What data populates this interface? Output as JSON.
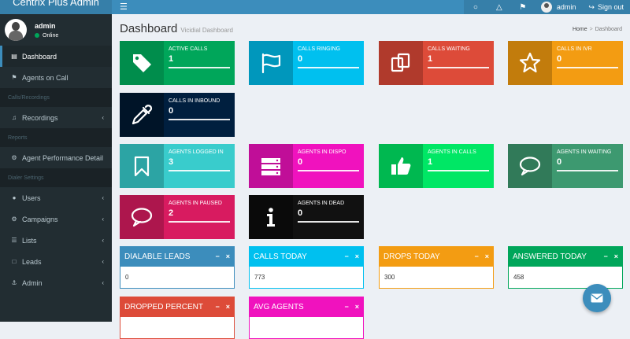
{
  "app": {
    "brand": "Centrix Plus Admin"
  },
  "topbar": {
    "user": "admin",
    "signout": "Sign out"
  },
  "sidebar": {
    "user": {
      "name": "admin",
      "status": "Online"
    },
    "items": [
      {
        "label": "Dashboard",
        "icon": "dashboard-icon"
      },
      {
        "label": "Agents on Call",
        "icon": "flag-icon"
      }
    ],
    "headers": [
      "Calls/Recordings",
      "Reports",
      "Dialer Settings"
    ],
    "recordings": {
      "label": "Recordings",
      "icon": "music-icon"
    },
    "reports": {
      "label": "Agent Performance Detail",
      "icon": "gear-icon"
    },
    "settings": [
      {
        "label": "Users",
        "icon": "users-icon"
      },
      {
        "label": "Campaigns",
        "icon": "gear-icon"
      },
      {
        "label": "Lists",
        "icon": "list-icon"
      },
      {
        "label": "Leads",
        "icon": "file-icon"
      },
      {
        "label": "Admin",
        "icon": "anchor-icon"
      }
    ]
  },
  "page": {
    "title": "Dashboard",
    "subtitle": "Vicidial Dashboard",
    "crumb_home": "Home",
    "crumb_current": "Dashboard"
  },
  "boxes": [
    {
      "label": "ACTIVE CALLS",
      "value": "1",
      "icon": "tag-icon",
      "color": "#00a65a",
      "dark": "#008d4c"
    },
    {
      "label": "CALLS RINGING",
      "value": "0",
      "icon": "flag-icon",
      "color": "#00c0ef",
      "dark": "#0097bc"
    },
    {
      "label": "CALLS WAITING",
      "value": "1",
      "icon": "copy-icon",
      "color": "#dd4b39",
      "dark": "#b03a2c"
    },
    {
      "label": "CALLS IN IVR",
      "value": "0",
      "icon": "star-icon",
      "color": "#f39c12",
      "dark": "#c27c0c"
    },
    {
      "label": "CALLS IN INBOUND",
      "value": "0",
      "icon": "eyedropper-icon",
      "color": "#001f3f",
      "dark": "#001428"
    },
    {
      "label": "AGENTS LOGGED IN",
      "value": "3",
      "icon": "bookmark-icon",
      "color": "#39cccc",
      "dark": "#2ca4a4"
    },
    {
      "label": "AGENTS IN DISPO",
      "value": "0",
      "icon": "server-icon",
      "color": "#f012be",
      "dark": "#c00e98"
    },
    {
      "label": "AGENTS IN CALLS",
      "value": "1",
      "icon": "thumbs-up-icon",
      "color": "#00e765",
      "dark": "#00b850"
    },
    {
      "label": "AGENTS IN WAITING",
      "value": "0",
      "icon": "comment-icon",
      "color": "#3d9970",
      "dark": "#317a59"
    },
    {
      "label": "AGENTS IN PAUSED",
      "value": "2",
      "icon": "comment-icon",
      "color": "#d81b60",
      "dark": "#ad164d"
    },
    {
      "label": "AGENTS IN DEAD",
      "value": "0",
      "icon": "info-icon",
      "color": "#111111",
      "dark": "#0a0a0a"
    }
  ],
  "panels": [
    {
      "title": "DIALABLE LEADS",
      "value": "0",
      "color": "#3c8dbc"
    },
    {
      "title": "CALLS TODAY",
      "value": "773",
      "color": "#00c0ef"
    },
    {
      "title": "DROPS TODAY",
      "value": "300",
      "color": "#f39c12"
    },
    {
      "title": "ANSWERED TODAY",
      "value": "458",
      "color": "#00a65a"
    },
    {
      "title": "DROPPED PERCENT",
      "value": "",
      "color": "#dd4b39"
    },
    {
      "title": "AVG AGENTS",
      "value": "",
      "color": "#f012be"
    }
  ],
  "panel_controls": {
    "minimize": "−",
    "close": "×"
  }
}
